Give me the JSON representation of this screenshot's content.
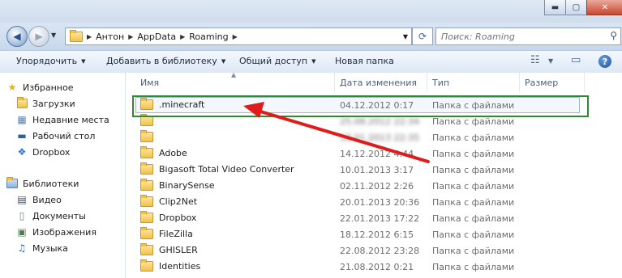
{
  "window": {
    "buttons": {
      "minimize": "▬",
      "maximize": "▢",
      "close": "✕"
    }
  },
  "address": {
    "crumbs": [
      "Антон",
      "AppData",
      "Roaming"
    ],
    "search_placeholder": "Поиск: Roaming"
  },
  "toolbar": {
    "organize": "Упорядочить",
    "add_library": "Добавить в библиотеку",
    "share": "Общий доступ",
    "new_folder": "Новая папка",
    "help": "?"
  },
  "nav": {
    "favorites": {
      "title": "Избранное",
      "items": [
        "Загрузки",
        "Недавние места",
        "Рабочий стол",
        "Dropbox"
      ]
    },
    "libraries": {
      "title": "Библиотеки",
      "items": [
        "Видео",
        "Документы",
        "Изображения",
        "Музыка"
      ]
    }
  },
  "columns": {
    "name": "Имя",
    "date": "Дата изменения",
    "type": "Тип",
    "size": "Размер"
  },
  "files": [
    {
      "name": ".minecraft",
      "date": "04.12.2012 0:17",
      "type": "Папка с файлами",
      "highlighted": true
    },
    {
      "name": "",
      "date": "25.08.2012 22:34",
      "type": "Папка с файлами",
      "blurred": true
    },
    {
      "name": "",
      "date": "18.01.2013 22:35",
      "type": "Папка с файлами",
      "blurred": true
    },
    {
      "name": "Adobe",
      "date": "14.12.2012 4:44",
      "type": "Папка с файлами"
    },
    {
      "name": "Bigasoft Total Video Converter",
      "date": "10.01.2013 3:17",
      "type": "Папка с файлами"
    },
    {
      "name": "BinarySense",
      "date": "02.11.2012 2:26",
      "type": "Папка с файлами"
    },
    {
      "name": "Clip2Net",
      "date": "20.01.2013 20:36",
      "type": "Папка с файлами"
    },
    {
      "name": "Dropbox",
      "date": "22.01.2013 17:22",
      "type": "Папка с файлами"
    },
    {
      "name": "FileZilla",
      "date": "18.12.2012 6:15",
      "type": "Папка с файлами"
    },
    {
      "name": "GHISLER",
      "date": "22.08.2012 23:28",
      "type": "Папка с файлами"
    },
    {
      "name": "Identities",
      "date": "21.08.2012 0:21",
      "type": "Папка с файлами"
    }
  ],
  "colors": {
    "highlight_frame": "#2f8a2f",
    "annotation_arrow": "#e01b1b"
  }
}
